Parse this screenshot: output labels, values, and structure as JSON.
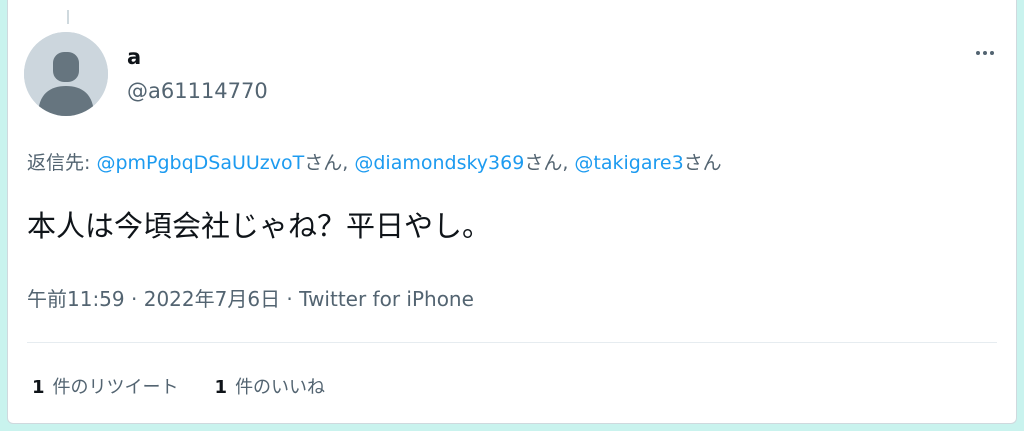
{
  "tweet": {
    "author": {
      "name": "a",
      "handle": "@a61114770",
      "avatar_icon": "default-avatar-icon"
    },
    "reply_to": {
      "prefix": "返信先: ",
      "users": [
        {
          "handle": "@pmPgbqDSaUUzvoT",
          "suffix": "さん, "
        },
        {
          "handle": "@diamondsky369",
          "suffix": "さん, "
        },
        {
          "handle": "@takigare3",
          "suffix": "さん"
        }
      ]
    },
    "text": "本人は今頃会社じゃね？平日やし。",
    "meta": {
      "time": "午前11:59",
      "separator1": " · ",
      "date": "2022年7月6日",
      "separator2": " · ",
      "source": "Twitter for iPhone"
    },
    "stats": {
      "retweets": {
        "count": "1",
        "label": "件のリツイート"
      },
      "likes": {
        "count": "1",
        "label": "件のいいね"
      }
    },
    "more_icon": "more-horizontal-icon"
  },
  "colors": {
    "background": "#c9f3ee",
    "link": "#1d9bf0",
    "secondary_text": "#536471",
    "primary_text": "#0f1419"
  }
}
